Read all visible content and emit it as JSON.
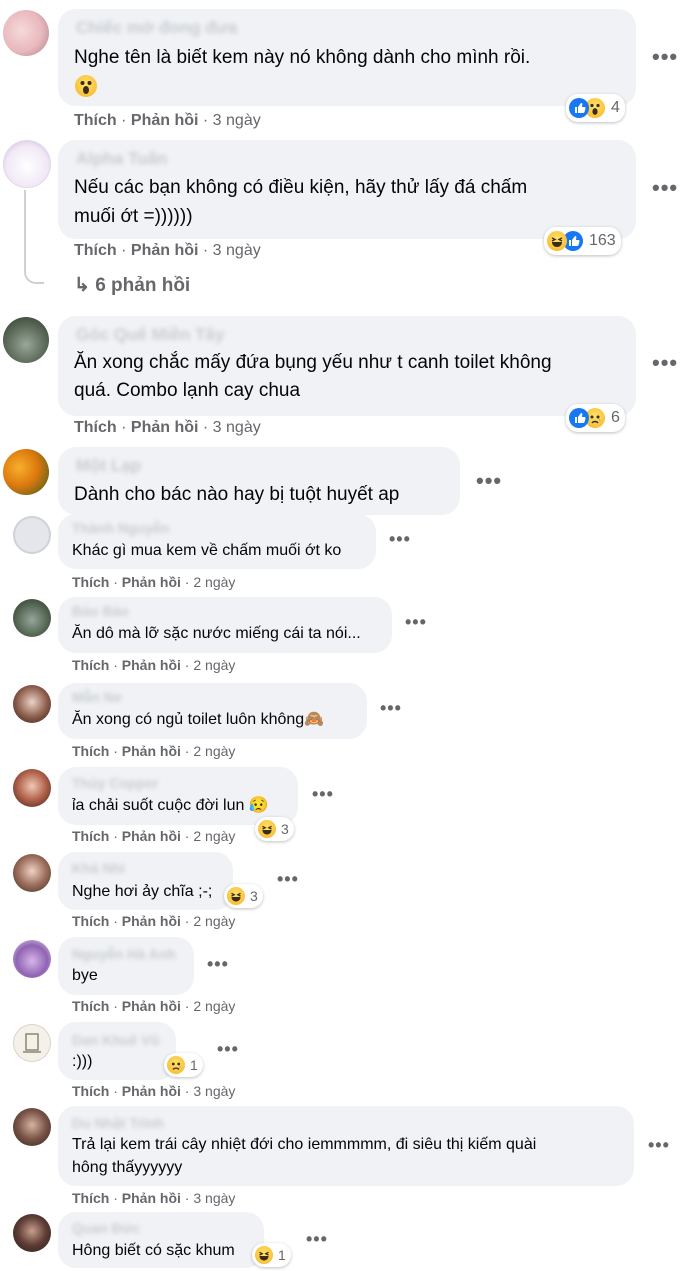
{
  "labels": {
    "like": "Thích",
    "reply": "Phản hồi",
    "sep": " · ",
    "more": "•••"
  },
  "comments": [
    {
      "name": "Chiếc mờ đong đưa",
      "text": "Nghe tên là biết kem này nó không dành cho mình rồi.",
      "time": "3 ngày",
      "reactions": {
        "icons": [
          "like-icon",
          "wow-icon"
        ],
        "count": "4"
      }
    },
    {
      "name": "Alpha Tuấn",
      "text": "Nếu các bạn không có điều kiện, hãy thử lấy đá chấm\nmuối ớt =))))))",
      "time": "3 ngày",
      "reactions": {
        "icons": [
          "haha-icon",
          "like-icon"
        ],
        "count": "163"
      },
      "replies_label": "6 phản hồi"
    },
    {
      "name": "Góc Quê Miền Tây",
      "text": "Ăn xong chắc mấy đứa bụng yếu như t canh toilet không\nquá. Combo lạnh cay chua",
      "time": "3 ngày",
      "reactions": {
        "icons": [
          "like-icon",
          "sad-icon"
        ],
        "count": "6"
      }
    },
    {
      "name": "Một Lạp",
      "text": "Dành cho bác nào hay bị tuột huyết ap"
    },
    {
      "name": "Thành Nguyễn",
      "text": "Khác gì mua kem về chấm muối ớt ko",
      "time": "2 ngày"
    },
    {
      "name": "Bảo Bảo",
      "text": "Ăn dô mà lỡ sặc nước miếng cái ta nói...",
      "time": "2 ngày"
    },
    {
      "name": "Mẫn Ne",
      "text": "Ăn xong có ngủ toilet luôn không",
      "emoji": "🙈",
      "time": "2 ngày"
    },
    {
      "name": "Thủy Copper",
      "text": "ỉa chải suốt cuộc đời lun",
      "emoji": "😥",
      "time": "2 ngày",
      "reactions": {
        "icons": [
          "haha-icon"
        ],
        "count": "3"
      }
    },
    {
      "name": "Khả Nhi",
      "text": "Nghe hơi ảy chĩa ;-;",
      "time": "2 ngày",
      "reactions": {
        "icons": [
          "haha-icon"
        ],
        "count": "3"
      }
    },
    {
      "name": "Nguyễn Hà Anh",
      "text": "bye",
      "time": "2 ngày"
    },
    {
      "name": "Dan Khuê Vũ",
      "text": ":)))",
      "time": "3 ngày",
      "reactions": {
        "icons": [
          "sad-icon"
        ],
        "count": "1"
      }
    },
    {
      "name": "Du Nhật Trình",
      "text": "Trả lại kem trái cây nhiệt đới cho iemmmmm, đi siêu thị kiếm quài\nhông thấyyyyyy",
      "time": "3 ngày"
    },
    {
      "name": "Quan Đức",
      "text": "Hông biết có sặc khum",
      "reactions": {
        "icons": [
          "haha-icon"
        ],
        "count": "1"
      }
    }
  ],
  "colors": {
    "bubble": "#f0f2f5",
    "secondary_text": "#65676b",
    "like_blue": "#1877f2",
    "emoji_yellow": "#f7b125"
  }
}
